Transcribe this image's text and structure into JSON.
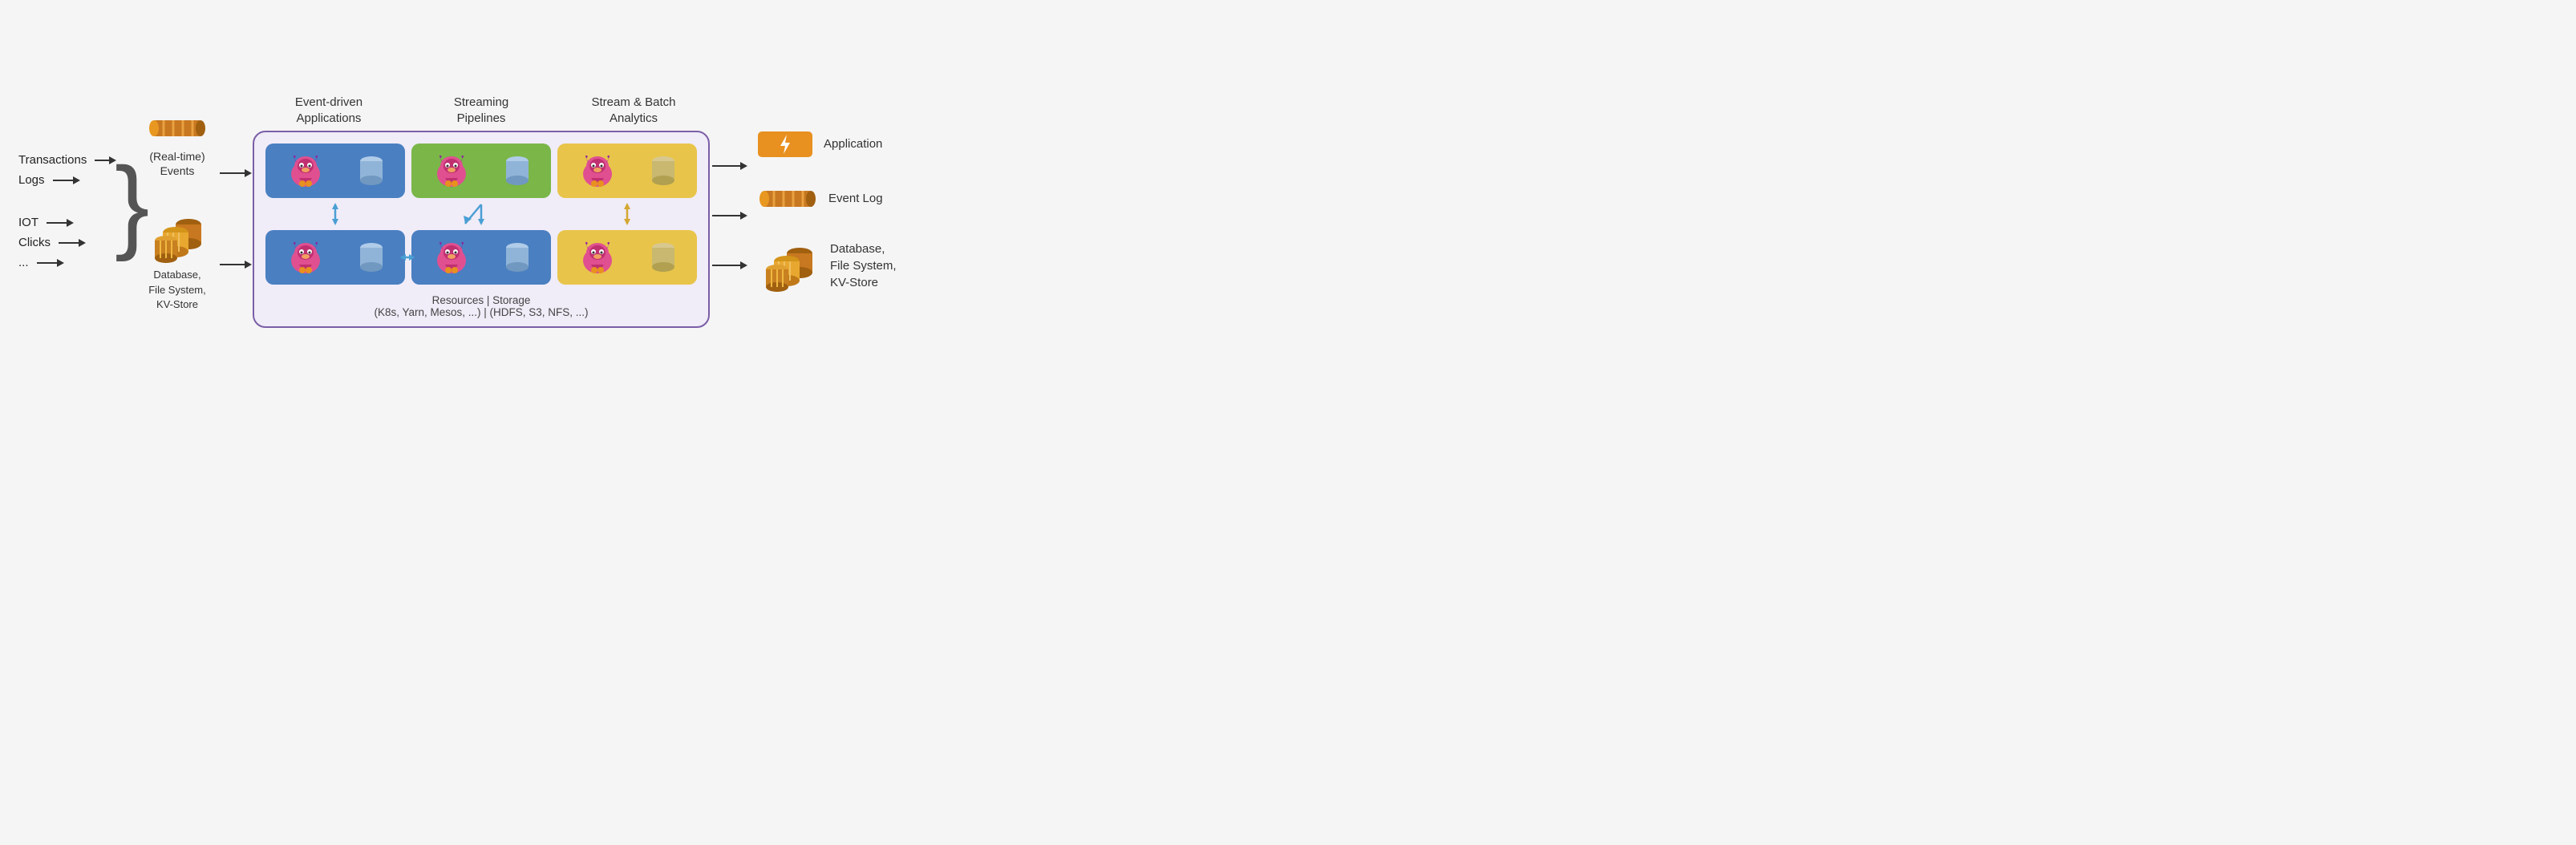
{
  "inputs": {
    "items": [
      "Transactions",
      "Logs",
      "IOT",
      "Clicks",
      "..."
    ]
  },
  "sources": {
    "events_label": "(Real-time)\nEvents",
    "database_label": "Database,\nFile System,\nKV-Store"
  },
  "col_headers": {
    "col1": "Event-driven\nApplications",
    "col2": "Streaming\nPipelines",
    "col3": "Stream & Batch\nAnalytics"
  },
  "resources_label": "Resources | Storage",
  "resources_sub": "(K8s, Yarn, Mesos, ...) | (HDFS, S3, NFS, ...)",
  "outputs": {
    "app_label": "Application",
    "event_log_label": "Event Log",
    "database_label": "Database,\nFile System,\nKV-Store"
  },
  "colors": {
    "blue": "#4a80c4",
    "green": "#7ab648",
    "yellow": "#d4a832",
    "yellow_light": "#e8c84a",
    "purple_border": "#7b5ea7",
    "orange_app": "#e89020",
    "orange_log": "#c87820",
    "orange_db": "#c87820",
    "arrow": "#333333",
    "dbl_arrow_blue": "#4a9fd4",
    "dbl_arrow_yellow": "#d4a832"
  }
}
